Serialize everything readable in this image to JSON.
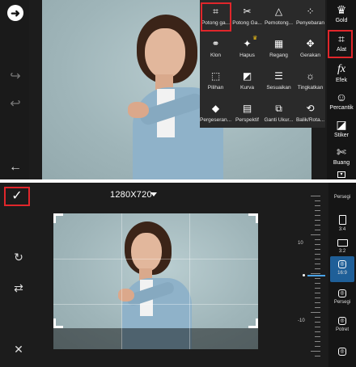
{
  "top_screen": {
    "tools_menu": [
      {
        "label": "Potong ga...",
        "icon": "crop-icon"
      },
      {
        "label": "Potong Ga...",
        "icon": "free-crop-icon"
      },
      {
        "label": "Pemotong...",
        "icon": "shape-crop-icon"
      },
      {
        "label": "Penyebaran",
        "icon": "dispersion-icon"
      },
      {
        "label": "Klon",
        "icon": "clone-icon"
      },
      {
        "label": "Hapus",
        "icon": "remove-icon"
      },
      {
        "label": "Regang",
        "icon": "stretch-icon"
      },
      {
        "label": "Gerakan",
        "icon": "motion-icon"
      },
      {
        "label": "Pilihan",
        "icon": "selection-icon"
      },
      {
        "label": "Kurva",
        "icon": "curves-icon"
      },
      {
        "label": "Sesuaikan",
        "icon": "adjust-icon"
      },
      {
        "label": "Tingkatkan",
        "icon": "enhance-icon"
      },
      {
        "label": "Pergeseran...",
        "icon": "tilt-shift-icon"
      },
      {
        "label": "Perspektif",
        "icon": "perspective-icon"
      },
      {
        "label": "Ganti Ukur...",
        "icon": "resize-icon"
      },
      {
        "label": "Balik/Rota...",
        "icon": "flip-rotate-icon"
      }
    ],
    "right_toolbar": [
      {
        "label": "Gold",
        "icon": "gold-crown-icon"
      },
      {
        "label": "Alat",
        "icon": "crop-tool-icon"
      },
      {
        "label": "Efek",
        "icon": "fx-icon"
      },
      {
        "label": "Percantik",
        "icon": "beautify-icon"
      },
      {
        "label": "Stiker",
        "icon": "sticker-icon"
      },
      {
        "label": "Buang",
        "icon": "cutout-icon"
      }
    ],
    "glyphs": {
      "next": "➜",
      "redo": "↪",
      "undo": "↩",
      "back": "←",
      "crown": "♛",
      "fx": "fx"
    }
  },
  "bottom_screen": {
    "ratio_title": "1280X720",
    "check": "✓",
    "glyphs": {
      "rotate": "↻",
      "flip": "⇄",
      "close": "✕"
    },
    "ruler_labels": [
      "10",
      "0",
      "-10"
    ],
    "aspect_ratios": [
      {
        "label": "Persegi",
        "kind": "shape"
      },
      {
        "label": "3:4",
        "kind": "shape"
      },
      {
        "label": "3:2",
        "kind": "shape"
      },
      {
        "label": "16:9",
        "kind": "insta-selected"
      },
      {
        "label": "Persegi",
        "kind": "insta"
      },
      {
        "label": "Potret",
        "kind": "insta"
      }
    ]
  },
  "colors": {
    "highlight": "#e0262b",
    "accent": "#1f5f98",
    "crown": "#f2c317"
  }
}
